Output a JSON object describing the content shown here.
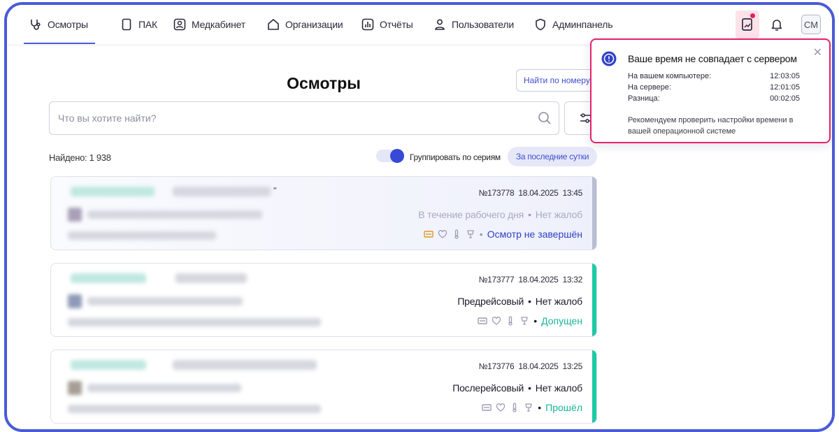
{
  "nav": {
    "items": [
      {
        "label": "Осмотры",
        "icon": "stethoscope-icon",
        "active": true
      },
      {
        "label": "ПАК",
        "icon": "device-icon"
      },
      {
        "label": "Медкабинет",
        "icon": "medcabinet-icon"
      },
      {
        "label": "Организации",
        "icon": "building-icon"
      },
      {
        "label": "Отчёты",
        "icon": "chart-icon"
      },
      {
        "label": "Пользователи",
        "icon": "users-icon"
      },
      {
        "label": "Админпанель",
        "icon": "shield-icon"
      }
    ],
    "avatar": "СМ"
  },
  "page": {
    "title": "Осмотры",
    "find_by_number": "Найти по номеру",
    "search_placeholder": "Что вы хотите найти?",
    "found": "Найдено: 1 938",
    "group_label": "Группировать по сериям",
    "group_on": true,
    "period": "За последние сутки"
  },
  "cards": [
    {
      "number": "№173778",
      "date": "18.04.2025",
      "time": "13:45",
      "type": "В течение рабочего дня",
      "complaints": "Нет жалоб",
      "status": "Осмотр не завершён",
      "status_color": "#3040c6",
      "strip_color": "#b9bdd4",
      "quote": "\""
    },
    {
      "number": "№173777",
      "date": "18.04.2025",
      "time": "13:32",
      "type": "Предрейсовый",
      "complaints": "Нет жалоб",
      "status": "Допущен",
      "status_color": "#18b59a",
      "strip_color": "#1ec9a6",
      "quote": ""
    },
    {
      "number": "№173776",
      "date": "18.04.2025",
      "time": "13:25",
      "type": "Послерейсовый",
      "complaints": "Нет жалоб",
      "status": "Прошёл",
      "status_color": "#18b59a",
      "strip_color": "#1ec9a6",
      "quote": ""
    }
  ],
  "toast": {
    "title": "Ваше время не совпадает с сервером",
    "rows": [
      {
        "label": "На вашем компьютере:",
        "value": "12:03:05"
      },
      {
        "label": "На сервере:",
        "value": "12:01:05"
      },
      {
        "label": "Разница:",
        "value": "00:02:05"
      }
    ],
    "recommendation": "Рекомендуем проверить настройки времени в вашей операционной системе"
  },
  "colors": {
    "accent": "#4a5bd8",
    "alert": "#e6206b",
    "success": "#18b59a"
  }
}
